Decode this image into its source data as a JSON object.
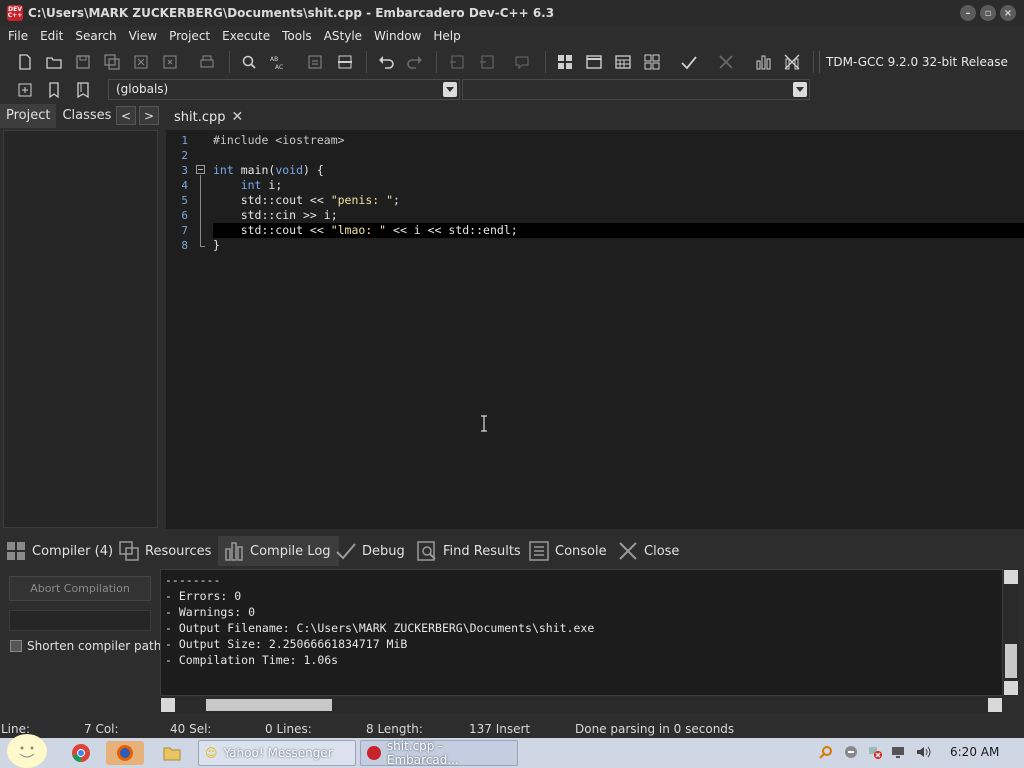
{
  "window": {
    "title": "C:\\Users\\MARK ZUCKERBERG\\Documents\\shit.cpp - Embarcadero Dev-C++ 6.3",
    "logo_text": "DEV C++"
  },
  "menu": [
    "File",
    "Edit",
    "Search",
    "View",
    "Project",
    "Execute",
    "Tools",
    "AStyle",
    "Window",
    "Help"
  ],
  "toolbar": {
    "compiler": "TDM-GCC 9.2.0 32-bit Release",
    "scope": "(globals)",
    "function": ""
  },
  "left_panel": {
    "tabs": [
      "Project",
      "Classes"
    ],
    "prev": "<",
    "next": ">"
  },
  "editor": {
    "tab": "shit.cpp",
    "tab_close": "✕",
    "line_numbers": [
      "1",
      "2",
      "3",
      "4",
      "5",
      "6",
      "7",
      "8"
    ]
  },
  "bottom_tabs": [
    "Compiler (4)",
    "Resources",
    "Compile Log",
    "Debug",
    "Find Results",
    "Console",
    "Close"
  ],
  "compile_panel": {
    "abort_label": "Abort Compilation",
    "shorten_label": "Shorten compiler path"
  },
  "log_lines": [
    "--------",
    "- Errors: 0",
    "- Warnings: 0",
    "- Output Filename: C:\\Users\\MARK ZUCKERBERG\\Documents\\shit.exe",
    "- Output Size: 2.25066661834717 MiB",
    "- Compilation Time: 1.06s"
  ],
  "status": {
    "line": "Line:",
    "line_val": "7 Col:",
    "col_val": "40 Sel:",
    "sel_val": "0 Lines:",
    "lines_val": "8 Length:",
    "length_val": "137 Insert",
    "message": "Done parsing in 0 seconds"
  },
  "taskbar": {
    "tasks": [
      "Yahoo! Messenger",
      "shit.cpp - Embarcad..."
    ],
    "clock": "6:20 AM"
  },
  "colors": {
    "editor_bg": "#1e1e1e",
    "keyword": "#7aa7ea",
    "string": "#f0e0a0",
    "line_number": "#7aa7d8"
  }
}
